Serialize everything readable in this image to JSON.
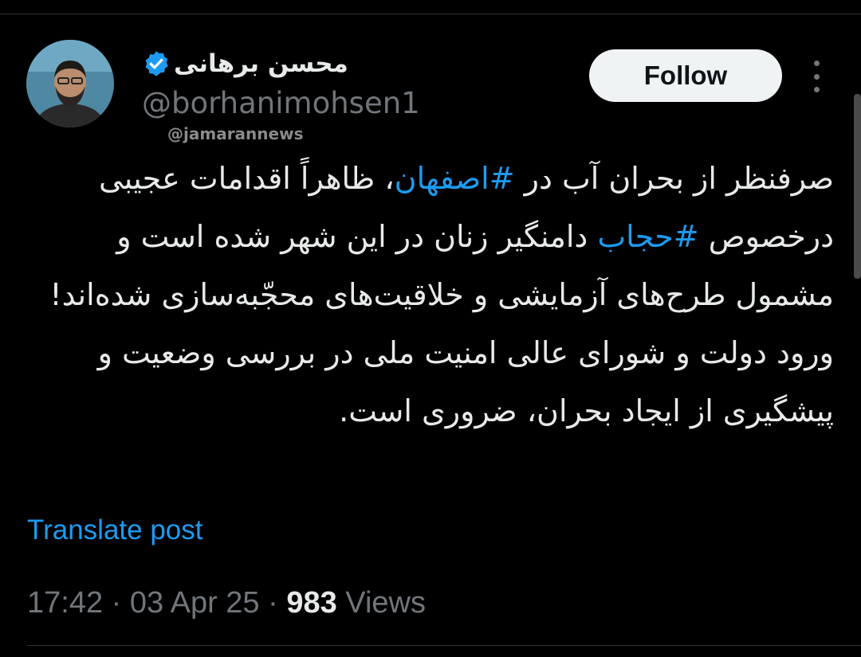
{
  "author": {
    "display_name": "محسن برهانی",
    "handle": "@borhanimohsen1",
    "verified_icon": "verified-badge-icon",
    "verified_color": "#1d9bf0",
    "avatar_icon": "profile-photo"
  },
  "source_label": "@jamarannews",
  "follow_button": {
    "label": "Follow"
  },
  "more_menu": {
    "icon": "more-vertical-icon"
  },
  "tweet": {
    "p1_a": "صرفنظر از بحران آب در ",
    "hashtag1": "#اصفهان",
    "p1_b": "، ظاهراً اقدامات عجیبی درخصوص ",
    "hashtag2": "#حجاب",
    "p1_c": " دامنگیر زنان در این شهر شده است و مشمول طرح‌های آزمایشی و خلاقیت‌های محجّبه‌سازی شده‌اند!",
    "p2": "ورود دولت و شورای عالی امنیت ملی در بررسی وضعیت و پیشگیری از ایجاد بحران، ضروری است.",
    "hashtag_color": "#1d9bf0"
  },
  "translate_link": "Translate post",
  "meta": {
    "time": "17:42",
    "sep1": " · ",
    "date": "03 Apr 25",
    "sep2": " · ",
    "views_count": "983",
    "views_label": " Views"
  }
}
